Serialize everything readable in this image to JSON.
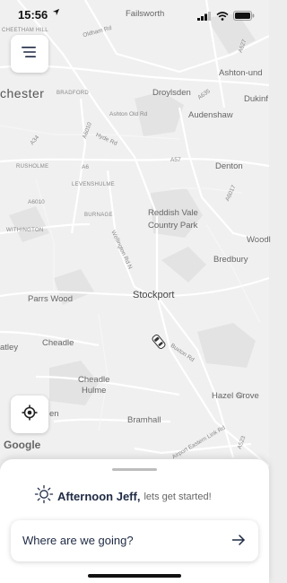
{
  "status_bar": {
    "time": "15:56",
    "location_icon": "location-arrow-icon",
    "icons": [
      "cellular-signal-icon",
      "wifi-icon",
      "battery-icon"
    ]
  },
  "map": {
    "labels": {
      "failsworth": "Failsworth",
      "cheetham_hill": "CHEETHAM HILL",
      "oldham_rd": "Oldham Rd",
      "a627": "A627",
      "ashton": "Ashton-und",
      "chester": "chester",
      "bradford": "BRADFORD",
      "droylsden": "Droylsden",
      "a635": "A635",
      "dukinf": "Dukinf",
      "ashton_old_rd": "Ashton Old Rd",
      "audenshaw": "Audenshaw",
      "a6010_top": "A6010",
      "hyde_rd": "Hyde Rd",
      "a34": "A34",
      "a57": "A57",
      "rusholme": "RUSHOLME",
      "a6": "A6",
      "denton": "Denton",
      "levenshulme": "LEVENSHULME",
      "a6017": "A6017",
      "a6010_mid": "A6010",
      "burnage": "BURNAGE",
      "reddish": "Reddish Vale",
      "country_park": "Country Park",
      "withington": "WITHINGTON",
      "wellington_rd": "Wellington Rd N",
      "woodl": "Woodl",
      "bredbury": "Bredbury",
      "parrs_wood": "Parrs Wood",
      "stockport": "Stockport",
      "cheadle": "Cheadle",
      "atley": "atley",
      "buxton_rd": "Buxton Rd",
      "cheadle_hulme_1": "Cheadle",
      "cheadle_hulme_2": "Hulme",
      "hazel_grove": "Hazel Grove",
      "a6_bottom": "A6",
      "en": "en",
      "bramhall": "Bramhall",
      "airport_rd": "Airport Eastern Link Rd",
      "a523": "A523"
    },
    "attribution": "Google",
    "car_icon": "car-marker-icon"
  },
  "buttons": {
    "menu_icon": "hamburger-menu-icon",
    "locate_icon": "locate-target-icon"
  },
  "sheet": {
    "greeting_icon": "sun-icon",
    "greeting_bold": "Afternoon Jeff,",
    "greeting_light": " lets get started!",
    "search_text": "Where are we going?",
    "search_arrow": "arrow-right-icon"
  }
}
